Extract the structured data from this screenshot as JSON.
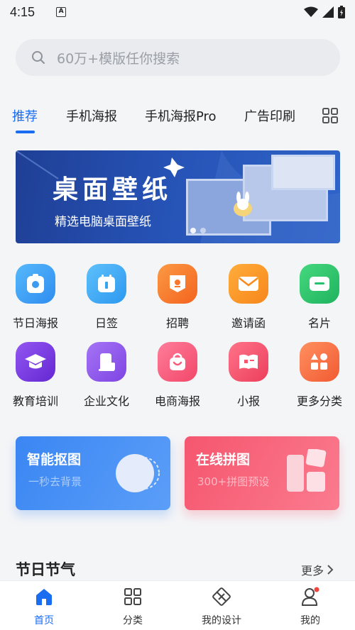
{
  "status_bar": {
    "time": "4:15",
    "badge": "A"
  },
  "search": {
    "placeholder": "60万+模版任你搜索"
  },
  "tabs": [
    {
      "label": "推荐",
      "active": true
    },
    {
      "label": "手机海报"
    },
    {
      "label": "手机海报Pro"
    },
    {
      "label": "广告印刷"
    }
  ],
  "banner": {
    "title": "桌面壁纸",
    "subtitle": "精选电脑桌面壁纸",
    "page_count": 2,
    "current_page": 1
  },
  "categories": [
    {
      "label": "节日海报",
      "color": "#3a9bf0",
      "icon": "photo-icon"
    },
    {
      "label": "日签",
      "color": "#35a5f2",
      "icon": "calendar-icon"
    },
    {
      "label": "招聘",
      "color": "#f9772b",
      "icon": "badge-icon"
    },
    {
      "label": "邀请函",
      "color": "#fb8a1d",
      "icon": "envelope-icon"
    },
    {
      "label": "名片",
      "color": "#24c26b",
      "icon": "card-icon"
    },
    {
      "label": "教育培训",
      "color": "#7a3fe0",
      "icon": "graduation-cap-icon"
    },
    {
      "label": "企业文化",
      "color": "#8e58ea",
      "icon": "building-icon"
    },
    {
      "label": "电商海报",
      "color": "#f85b7e",
      "icon": "shopping-bag-icon"
    },
    {
      "label": "小报",
      "color": "#f7566f",
      "icon": "newspaper-icon"
    },
    {
      "label": "更多分类",
      "color": "#f87044",
      "icon": "shapes-icon"
    }
  ],
  "feature_cards": [
    {
      "title": "智能抠图",
      "subtitle": "一秒去背景",
      "color": "#3f8cf3"
    },
    {
      "title": "在线拼图",
      "subtitle": "300+拼图预设",
      "color": "#f86177"
    }
  ],
  "section": {
    "title": "节日节气",
    "more": "更多"
  },
  "bottom_nav": [
    {
      "label": "首页",
      "active": true,
      "icon": "home-icon"
    },
    {
      "label": "分类",
      "icon": "grid-icon"
    },
    {
      "label": "我的设计",
      "icon": "design-icon"
    },
    {
      "label": "我的",
      "icon": "profile-icon"
    }
  ],
  "accent_color": "#1a6cf0"
}
